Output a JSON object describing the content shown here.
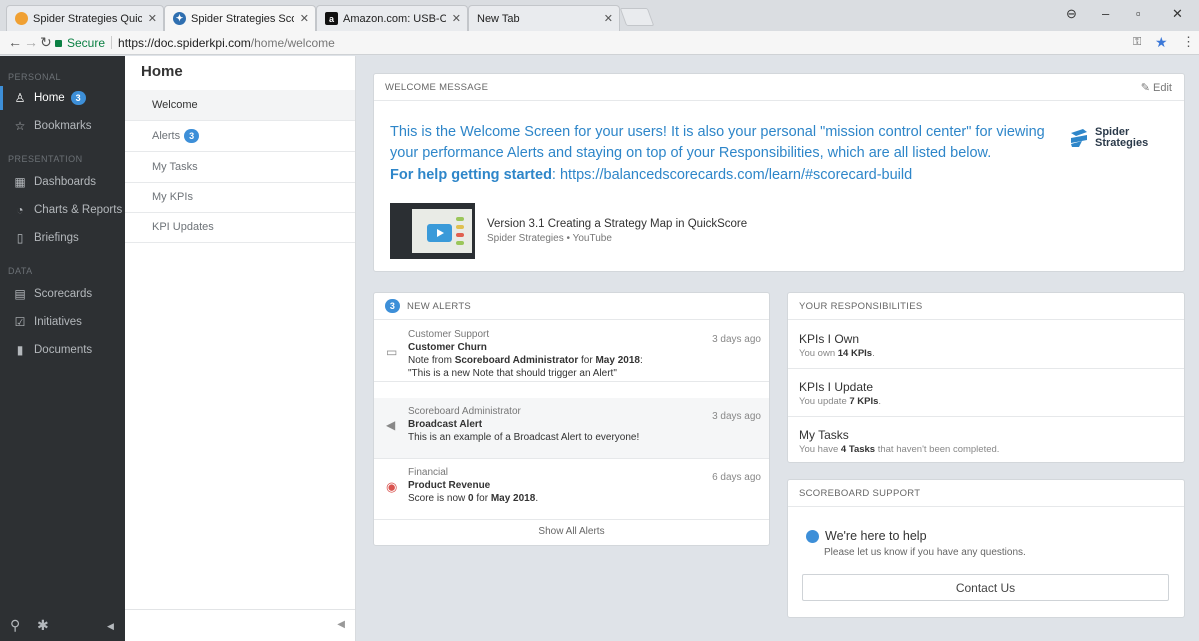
{
  "browser": {
    "tabs": [
      {
        "label": "Spider Strategies QuickSc",
        "icon": "spider-favicon"
      },
      {
        "label": "Spider Strategies Scoreb",
        "icon": "spider-favicon"
      },
      {
        "label": "Amazon.com: USB-C To I",
        "icon": "amazon-favicon"
      },
      {
        "label": "New Tab",
        "icon": ""
      }
    ],
    "secure_label": "Secure",
    "url_host": "https://doc.spiderkpi.com",
    "url_path": "/home/welcome"
  },
  "sidebar": {
    "sections": {
      "personal": "PERSONAL",
      "presentation": "PRESENTATION",
      "data": "DATA"
    },
    "items": [
      {
        "label": "Home",
        "badge": "3",
        "icon": "home-user-icon"
      },
      {
        "label": "Bookmarks",
        "icon": "star-icon"
      },
      {
        "label": "Dashboards",
        "icon": "dashboard-icon"
      },
      {
        "label": "Charts & Reports",
        "icon": "pie-chart-icon"
      },
      {
        "label": "Briefings",
        "icon": "book-icon"
      },
      {
        "label": "Scorecards",
        "icon": "scorecard-icon"
      },
      {
        "label": "Initiatives",
        "icon": "checkbox-icon"
      },
      {
        "label": "Documents",
        "icon": "document-icon"
      }
    ]
  },
  "subnav": {
    "title": "Home",
    "items": [
      {
        "label": "Welcome"
      },
      {
        "label": "Alerts",
        "badge": "3"
      },
      {
        "label": "My Tasks"
      },
      {
        "label": "My KPIs"
      },
      {
        "label": "KPI Updates"
      }
    ]
  },
  "welcome": {
    "header": "WELCOME MESSAGE",
    "edit_label": "Edit",
    "message": "This is the Welcome Screen for your users!  It is also your personal \"mission control center\" for viewing your performance Alerts and staying on top of your Responsibilities, which are all listed below.",
    "help_bold": "For help getting started",
    "help_rest": ": https://balancedscorecards.com/learn/#scorecard-build",
    "logo_line1": "Spider",
    "logo_line2": "Strategies",
    "video_title": "Version 3.1 Creating a Strategy Map in QuickScore",
    "video_source": "Spider Strategies • YouTube"
  },
  "alerts": {
    "count": "3",
    "header": "NEW ALERTS",
    "items": [
      {
        "source": "Customer Support",
        "title": "Customer Churn",
        "line1_pre": "Note from ",
        "line1_bold": "Scoreboard Administrator",
        "line1_mid": " for ",
        "line1_bold2": "May 2018",
        "line1_post": ":",
        "line2": "\"This is a new Note that should trigger an Alert\"",
        "age": "3 days ago",
        "icon": "note-icon"
      },
      {
        "source": "Scoreboard Administrator",
        "title": "Broadcast Alert",
        "line1": "This is an example of a Broadcast Alert to everyone!",
        "age": "3 days ago",
        "icon": "megaphone-icon"
      },
      {
        "source": "Financial",
        "title": "Product Revenue",
        "line1_pre": "Score is now ",
        "line1_bold": "0",
        "line1_mid": " for ",
        "line1_bold2": "May 2018",
        "line1_post": ".",
        "age": "6 days ago",
        "icon": "red-status-icon"
      }
    ],
    "show_all": "Show All Alerts"
  },
  "responsibilities": {
    "header": "YOUR RESPONSIBILITIES",
    "items": [
      {
        "title": "KPIs I Own",
        "pre": "You own ",
        "bold": "14 KPIs",
        "post": "."
      },
      {
        "title": "KPIs I Update",
        "pre": "You update ",
        "bold": "7 KPIs",
        "post": "."
      },
      {
        "title": "My Tasks",
        "pre": "You have ",
        "bold": "4 Tasks",
        "post": " that haven't been completed."
      }
    ]
  },
  "support": {
    "header": "SCOREBOARD SUPPORT",
    "title": "We're here to help",
    "subtitle": "Please let us know if you have any questions.",
    "button": "Contact Us"
  },
  "colors": {
    "accent": "#3d8fd8",
    "link_blue": "#2e86c9",
    "sidebar_bg": "#2d3033"
  }
}
